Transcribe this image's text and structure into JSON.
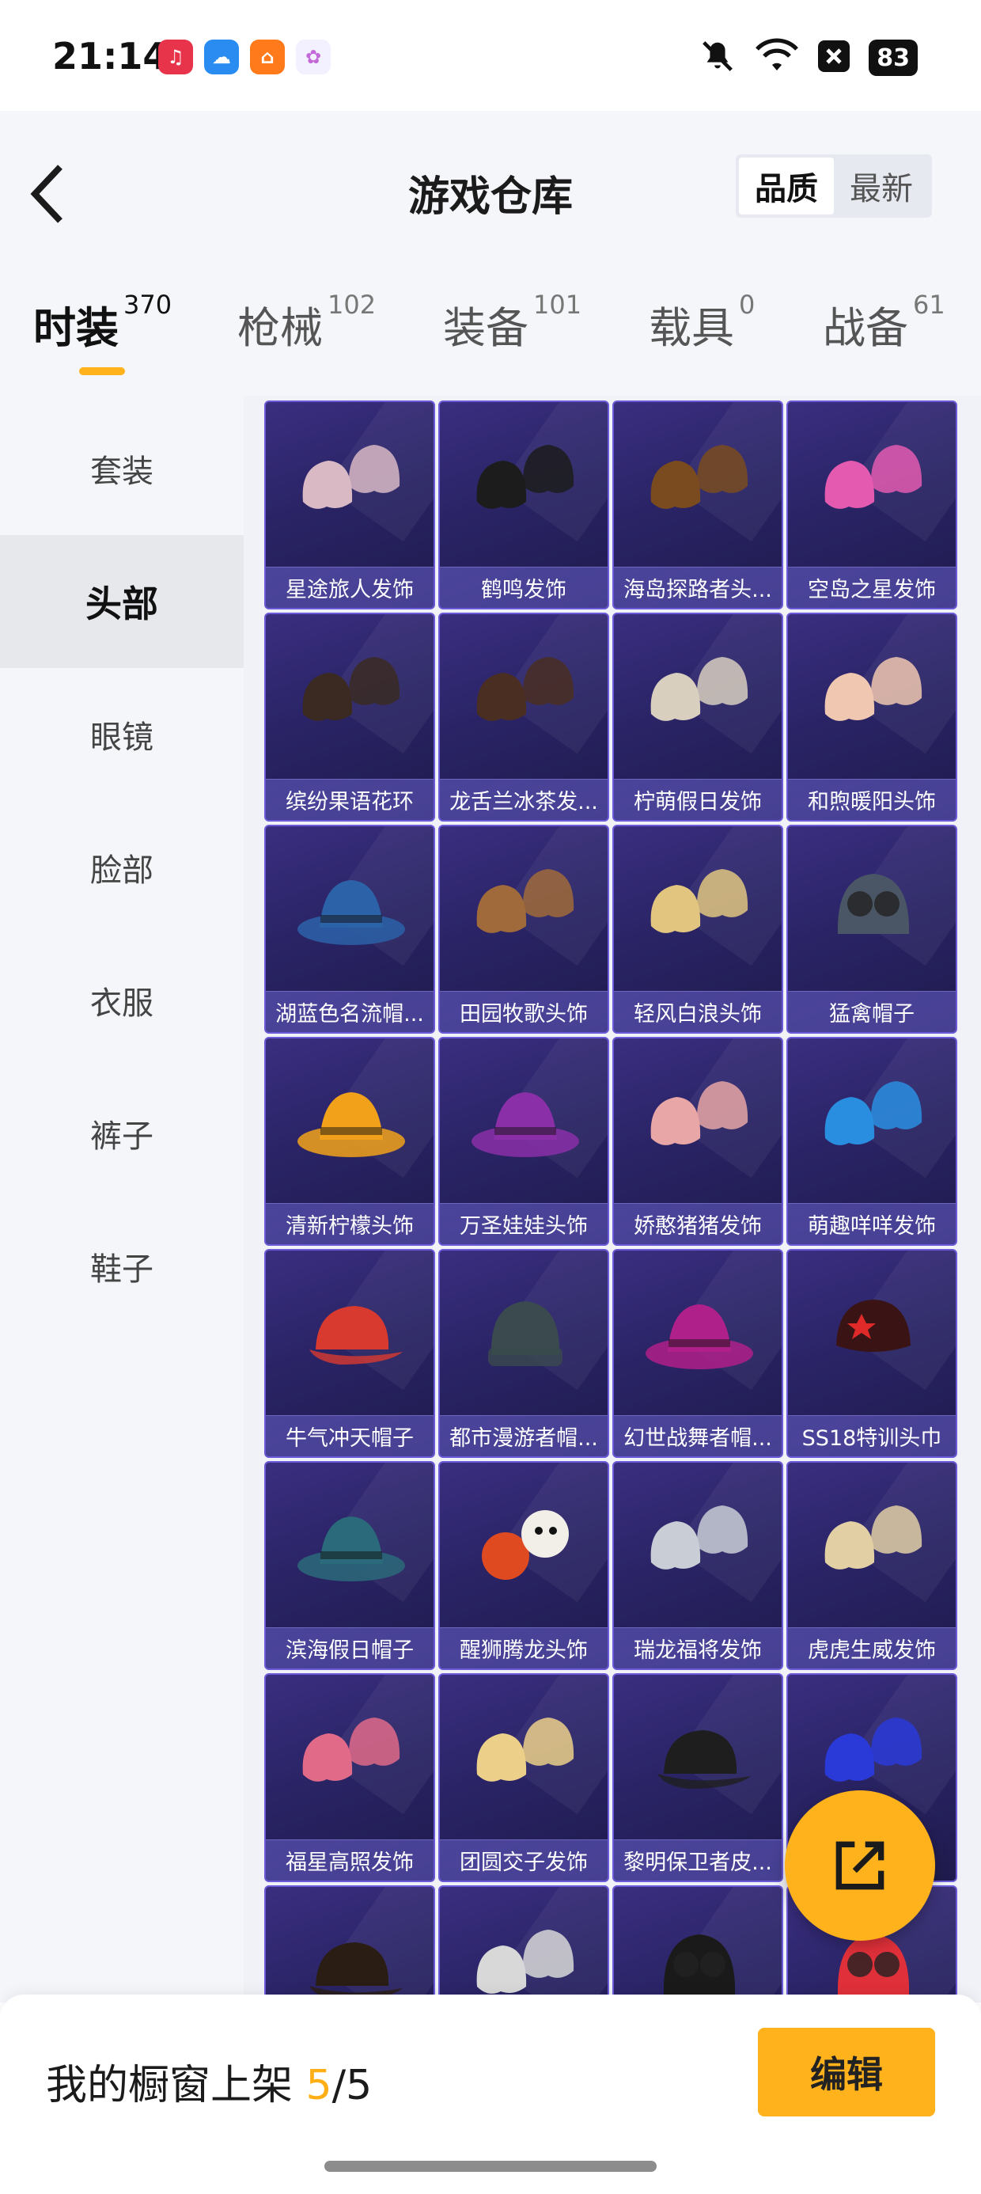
{
  "status_bar": {
    "time": "21:14",
    "battery": "83",
    "notification_icons": [
      {
        "name": "music-app-icon",
        "color": "#e8344b",
        "glyph": "♫"
      },
      {
        "name": "cloud-app-icon",
        "color": "#2a8cf0",
        "glyph": "☁"
      },
      {
        "name": "home-app-icon",
        "color": "#ff7a1a",
        "glyph": "⌂"
      },
      {
        "name": "flower-app-icon",
        "color": "#f3f0ff",
        "glyph": "✿"
      }
    ]
  },
  "header": {
    "title": "游戏仓库",
    "sort": [
      {
        "label": "品质",
        "active": true
      },
      {
        "label": "最新",
        "active": false
      }
    ]
  },
  "category_tabs": [
    {
      "label": "时装",
      "count": "370",
      "active": true
    },
    {
      "label": "枪械",
      "count": "102",
      "active": false
    },
    {
      "label": "装备",
      "count": "101",
      "active": false
    },
    {
      "label": "载具",
      "count": "0",
      "active": false
    },
    {
      "label": "战备",
      "count": "61",
      "active": false
    }
  ],
  "sidebar": {
    "items": [
      {
        "label": "套装",
        "active": false
      },
      {
        "label": "头部",
        "active": true
      },
      {
        "label": "眼镜",
        "active": false
      },
      {
        "label": "脸部",
        "active": false
      },
      {
        "label": "衣服",
        "active": false
      },
      {
        "label": "裤子",
        "active": false
      },
      {
        "label": "鞋子",
        "active": false
      }
    ]
  },
  "items": [
    {
      "label": "星途旅人发饰",
      "icon": "hair-icon",
      "color": "#d9b9c4"
    },
    {
      "label": "鹤鸣发饰",
      "icon": "hair-icon",
      "color": "#1c1c1c"
    },
    {
      "label": "海岛探路者头...",
      "icon": "hair-icon",
      "color": "#7a4b1e"
    },
    {
      "label": "空岛之星发饰",
      "icon": "hair-icon",
      "color": "#e45ab0"
    },
    {
      "label": "缤纷果语花环",
      "icon": "hair-icon",
      "color": "#3a2a22"
    },
    {
      "label": "龙舌兰冰茶发...",
      "icon": "hair-icon",
      "color": "#4a2e22"
    },
    {
      "label": "柠萌假日发饰",
      "icon": "hair-icon",
      "color": "#d8cfbf"
    },
    {
      "label": "和煦暖阳头饰",
      "icon": "hair-icon",
      "color": "#f0c7b0"
    },
    {
      "label": "湖蓝色名流帽...",
      "icon": "hat-icon",
      "color": "#2c62a8"
    },
    {
      "label": "田园牧歌头饰",
      "icon": "hair-icon",
      "color": "#a06a3a"
    },
    {
      "label": "轻风白浪头饰",
      "icon": "hair-icon",
      "color": "#e2c680"
    },
    {
      "label": "猛禽帽子",
      "icon": "helmet-icon",
      "color": "#4a5566"
    },
    {
      "label": "清新柠檬头饰",
      "icon": "hat-icon",
      "color": "#f2a21a"
    },
    {
      "label": "万圣娃娃头饰",
      "icon": "hat-icon",
      "color": "#8a2fa8"
    },
    {
      "label": "娇憨猪猪发饰",
      "icon": "hair-icon",
      "color": "#e8a6a6"
    },
    {
      "label": "萌趣咩咩发饰",
      "icon": "hair-icon",
      "color": "#2a8ee0"
    },
    {
      "label": "牛气冲天帽子",
      "icon": "cap-icon",
      "color": "#d83a30"
    },
    {
      "label": "都市漫游者帽...",
      "icon": "beanie-icon",
      "color": "#3a4a4e"
    },
    {
      "label": "幻世战舞者帽...",
      "icon": "hat-icon",
      "color": "#b0208a"
    },
    {
      "label": "SS18特训头巾",
      "icon": "bandana-icon",
      "color": "#3a1414"
    },
    {
      "label": "滨海假日帽子",
      "icon": "hat-icon",
      "color": "#2a6a7a"
    },
    {
      "label": "醒狮腾龙头饰",
      "icon": "lion-icon",
      "color": "#e04a20"
    },
    {
      "label": "瑞龙福将发饰",
      "icon": "hair-icon",
      "color": "#c9ced6"
    },
    {
      "label": "虎虎生威发饰",
      "icon": "hair-icon",
      "color": "#e2cfa4"
    },
    {
      "label": "福星高照发饰",
      "icon": "hair-icon",
      "color": "#e06a88"
    },
    {
      "label": "团圆交子发饰",
      "icon": "hair-icon",
      "color": "#ecd08a"
    },
    {
      "label": "黎明保卫者皮...",
      "icon": "cap-icon",
      "color": "#1e1e1e"
    },
    {
      "label": "",
      "icon": "hair-icon",
      "color": "#2a3ad8"
    },
    {
      "label": "",
      "icon": "cap-icon",
      "color": "#2a1e14"
    },
    {
      "label": "",
      "icon": "hair-icon",
      "color": "#d8d8d8"
    },
    {
      "label": "",
      "icon": "helmet-icon",
      "color": "#1a1a1a"
    },
    {
      "label": "",
      "icon": "helmet-icon",
      "color": "#e0303a"
    }
  ],
  "bottom": {
    "showcase_prefix": "我的橱窗上架 ",
    "showcase_count": "5",
    "showcase_total": "/5",
    "edit_label": "编辑"
  },
  "colors": {
    "accent": "#ffb21c",
    "card_border": "#6a5ad8",
    "card_bg": "#2a2466"
  }
}
